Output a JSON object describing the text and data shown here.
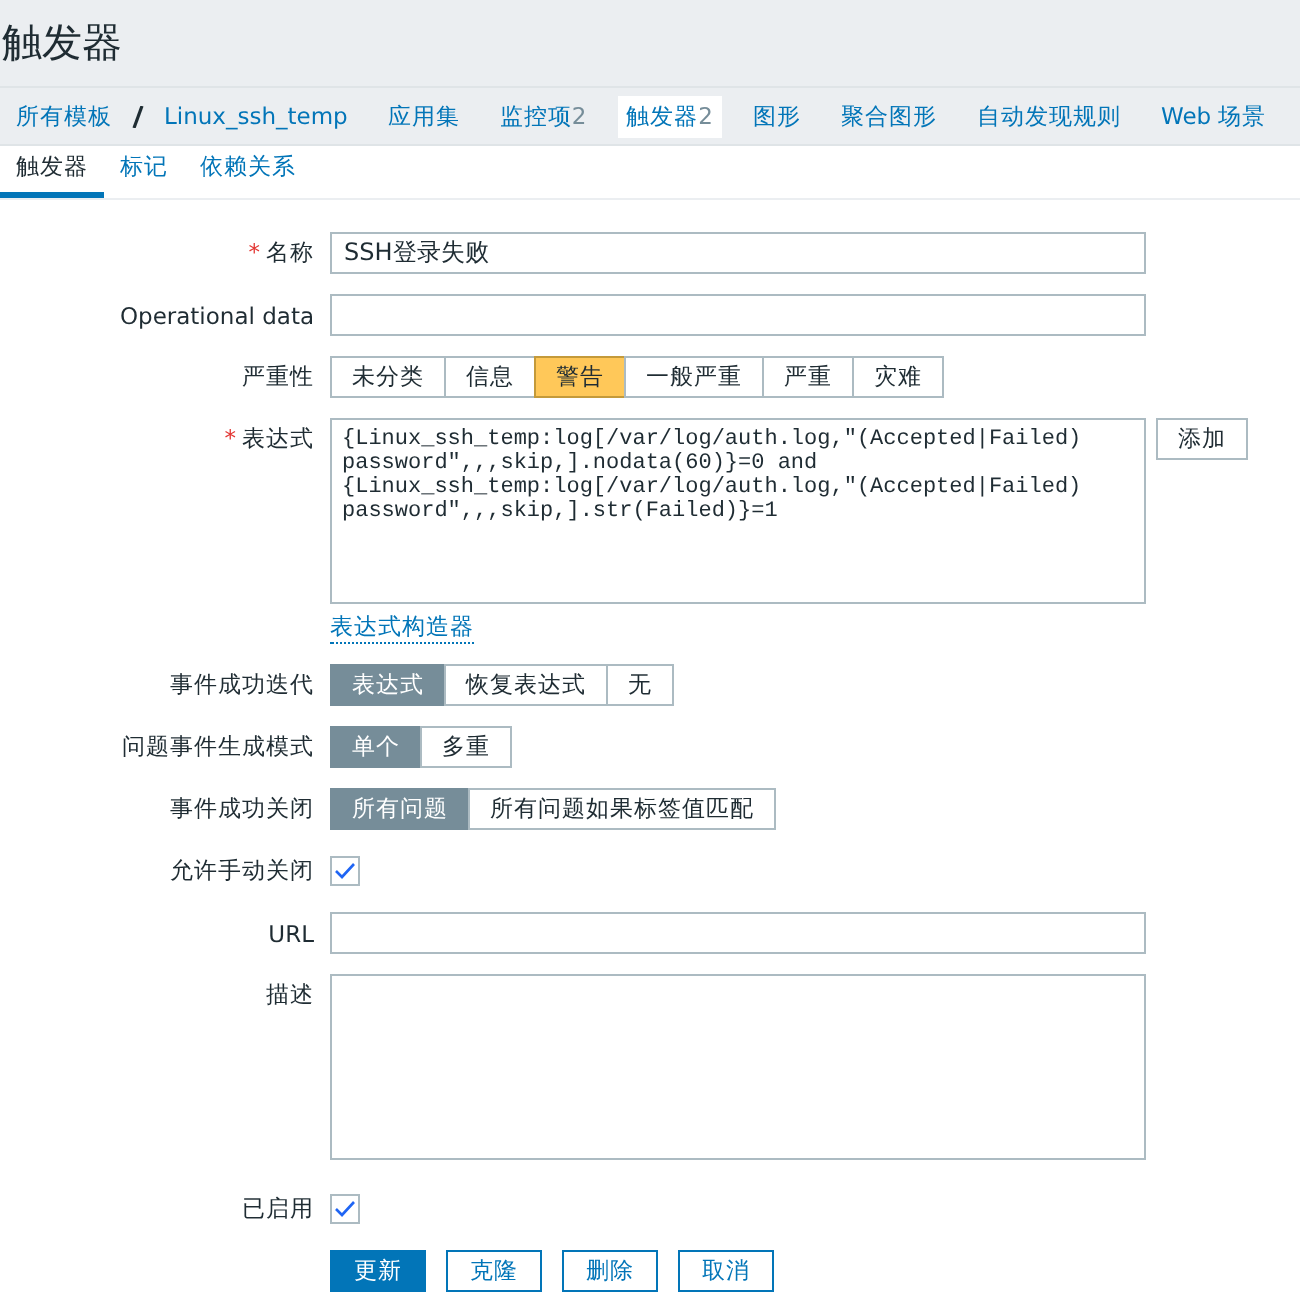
{
  "page_title": "触发器",
  "breadcrumbs": [
    {
      "label": "所有模板",
      "selected": false
    },
    {
      "label": "Linux_ssh_temp",
      "selected": false
    },
    {
      "label": "应用集",
      "selected": false
    },
    {
      "label": "监控项",
      "count": "2",
      "selected": false
    },
    {
      "label": "触发器",
      "count": "2",
      "selected": true
    },
    {
      "label": "图形",
      "selected": false
    },
    {
      "label": "聚合图形",
      "selected": false
    },
    {
      "label": "自动发现规则",
      "selected": false
    },
    {
      "label": "Web 场景",
      "selected": false
    }
  ],
  "tabs": [
    {
      "label": "触发器",
      "selected": true
    },
    {
      "label": "标记",
      "selected": false
    },
    {
      "label": "依赖关系",
      "selected": false
    }
  ],
  "form": {
    "name": {
      "label": "名称",
      "required_mark": "*",
      "value": "SSH登录失败"
    },
    "operational_data": {
      "label": "Operational data"
    },
    "severity": {
      "label": "严重性",
      "options": [
        {
          "label": "未分类",
          "selected": false
        },
        {
          "label": "信息",
          "selected": false
        },
        {
          "label": "警告",
          "selected": true,
          "color": "#ffc859"
        },
        {
          "label": "一般严重",
          "selected": false
        },
        {
          "label": "严重",
          "selected": false
        },
        {
          "label": "灾难",
          "selected": false
        }
      ]
    },
    "expression": {
      "label": "表达式",
      "required_mark": "*",
      "value": "{Linux_ssh_temp:log[/var/log/auth.log,\"(Accepted|Failed) password\",,,skip,].nodata(60)}=0 and {Linux_ssh_temp:log[/var/log/auth.log,\"(Accepted|Failed) password\",,,skip,].str(Failed)}=1",
      "add_button": "添加",
      "builder_link": "表达式构造器"
    },
    "ok_event_generation": {
      "label": "事件成功迭代",
      "options": [
        {
          "label": "表达式",
          "selected": true
        },
        {
          "label": "恢复表达式",
          "selected": false
        },
        {
          "label": "无",
          "selected": false
        }
      ]
    },
    "problem_event_mode": {
      "label": "问题事件生成模式",
      "options": [
        {
          "label": "单个",
          "selected": true
        },
        {
          "label": "多重",
          "selected": false
        }
      ]
    },
    "ok_event_closes": {
      "label": "事件成功关闭",
      "options": [
        {
          "label": "所有问题",
          "selected": true
        },
        {
          "label": "所有问题如果标签值匹配",
          "selected": false
        }
      ]
    },
    "allow_manual_close": {
      "label": "允许手动关闭",
      "checked": true
    },
    "url": {
      "label": "URL"
    },
    "description": {
      "label": "描述"
    },
    "enabled": {
      "label": "已启用",
      "checked": true
    },
    "buttons": [
      {
        "label": "更新",
        "kind": "primary"
      },
      {
        "label": "克隆",
        "kind": "secondary"
      },
      {
        "label": "删除",
        "kind": "secondary"
      },
      {
        "label": "取消",
        "kind": "secondary"
      }
    ]
  }
}
